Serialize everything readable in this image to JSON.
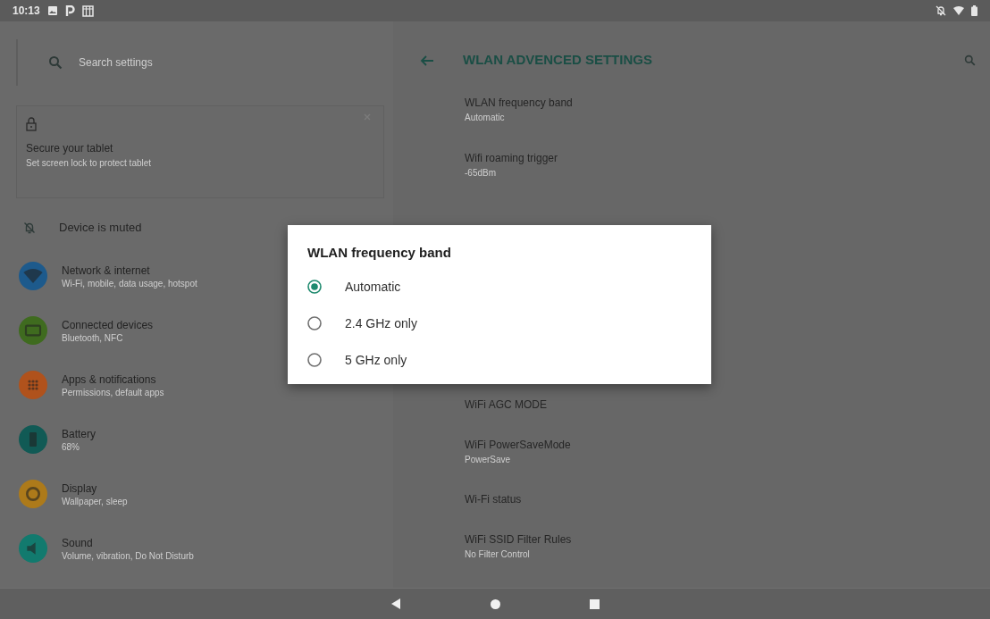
{
  "status_bar": {
    "time": "10:13"
  },
  "search": {
    "placeholder": "Search settings"
  },
  "suggestion_card": {
    "title": "Secure your tablet",
    "subtitle": "Set screen lock to protect tablet"
  },
  "muted_notice": {
    "label": "Device is muted"
  },
  "categories": [
    {
      "kind": "wifi",
      "title": "Network & internet",
      "subtitle": "Wi-Fi, mobile, data usage, hotspot",
      "color": "#1d5a8c"
    },
    {
      "kind": "devices",
      "title": "Connected devices",
      "subtitle": "Bluetooth, NFC",
      "color": "#3f6b1f"
    },
    {
      "kind": "apps",
      "title": "Apps & notifications",
      "subtitle": "Permissions, default apps",
      "color": "#b0521c"
    },
    {
      "kind": "battery",
      "title": "Battery",
      "subtitle": "68%",
      "color": "#115a55"
    },
    {
      "kind": "display",
      "title": "Display",
      "subtitle": "Wallpaper, sleep",
      "color": "#ad7a1a"
    },
    {
      "kind": "sound",
      "title": "Sound",
      "subtitle": "Volume, vibration, Do Not Disturb",
      "color": "#127a6e"
    }
  ],
  "toolbar": {
    "title": "WLAN ADVENCED SETTINGS"
  },
  "settings_top": [
    {
      "title": "WLAN frequency band",
      "summary": "Automatic"
    },
    {
      "title": "Wifi roaming trigger",
      "summary": "-65dBm"
    }
  ],
  "settings_bottom": [
    {
      "title": "WiFi AGC MODE"
    },
    {
      "title": "WiFi PowerSaveMode",
      "summary": "PowerSave"
    },
    {
      "title": "Wi-Fi status"
    },
    {
      "title": "WiFi SSID Filter Rules",
      "summary": "No Filter Control"
    }
  ],
  "dialog": {
    "title": "WLAN frequency band",
    "options": [
      {
        "label": "Automatic",
        "selected": true
      },
      {
        "label": "2.4 GHz only",
        "selected": false
      },
      {
        "label": "5 GHz only",
        "selected": false
      }
    ]
  }
}
